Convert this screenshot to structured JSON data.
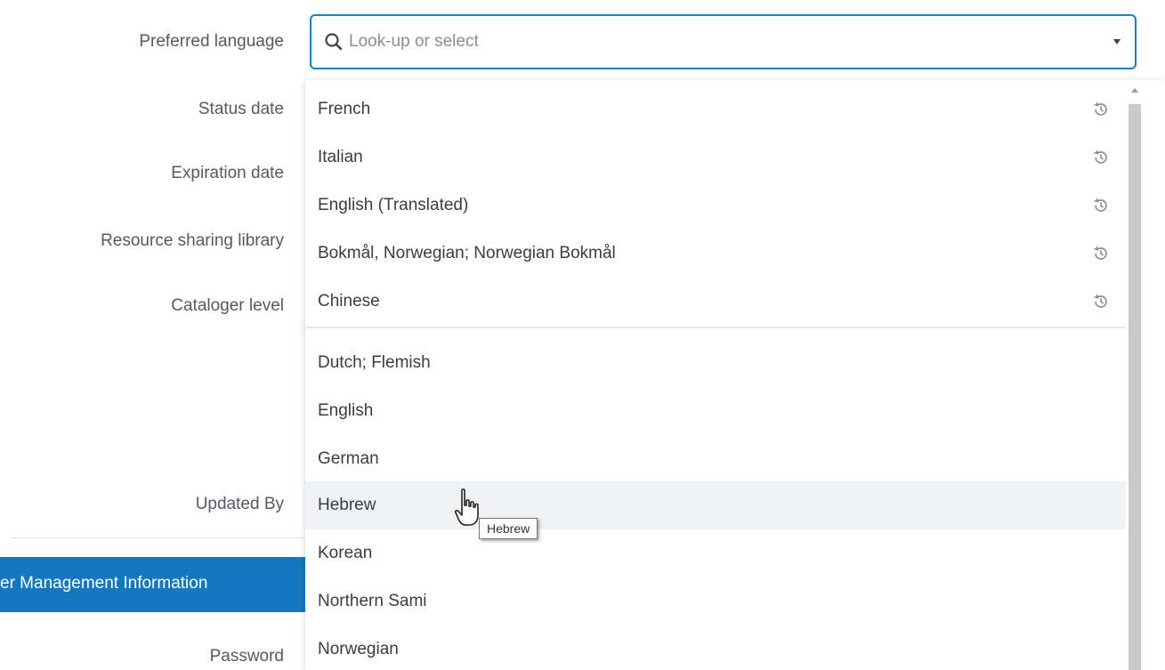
{
  "form": {
    "labels": {
      "preferred_language": "Preferred language",
      "status_date": "Status date",
      "expiration_date": "Expiration date",
      "resource_sharing_library": "Resource sharing library",
      "cataloger_level": "Cataloger level",
      "updated_by": "Updated By",
      "password": "Password"
    },
    "section_title": "er Management Information"
  },
  "combo": {
    "placeholder": "Look-up or select",
    "value": "",
    "icon": "search-icon",
    "caret_icon": "chevron-down-icon"
  },
  "dropdown": {
    "recent_options": [
      {
        "label": "French",
        "icon": "history-icon"
      },
      {
        "label": "Italian",
        "icon": "history-icon"
      },
      {
        "label": "English (Translated)",
        "icon": "history-icon"
      },
      {
        "label": "Bokmål, Norwegian; Norwegian Bokmål",
        "icon": "history-icon"
      },
      {
        "label": "Chinese",
        "icon": "history-icon"
      }
    ],
    "options": [
      {
        "label": "Dutch; Flemish"
      },
      {
        "label": "English"
      },
      {
        "label": "German"
      },
      {
        "label": "Hebrew",
        "hovered": true
      },
      {
        "label": "Korean"
      },
      {
        "label": "Northern Sami"
      },
      {
        "label": "Norwegian"
      }
    ]
  },
  "tooltip": {
    "text": "Hebrew"
  },
  "colors": {
    "accent": "#1f7fc6",
    "section_bar": "#1478c0",
    "hover_row": "#f1f2f3",
    "scrollbar_thumb": "#c9c9c9"
  }
}
